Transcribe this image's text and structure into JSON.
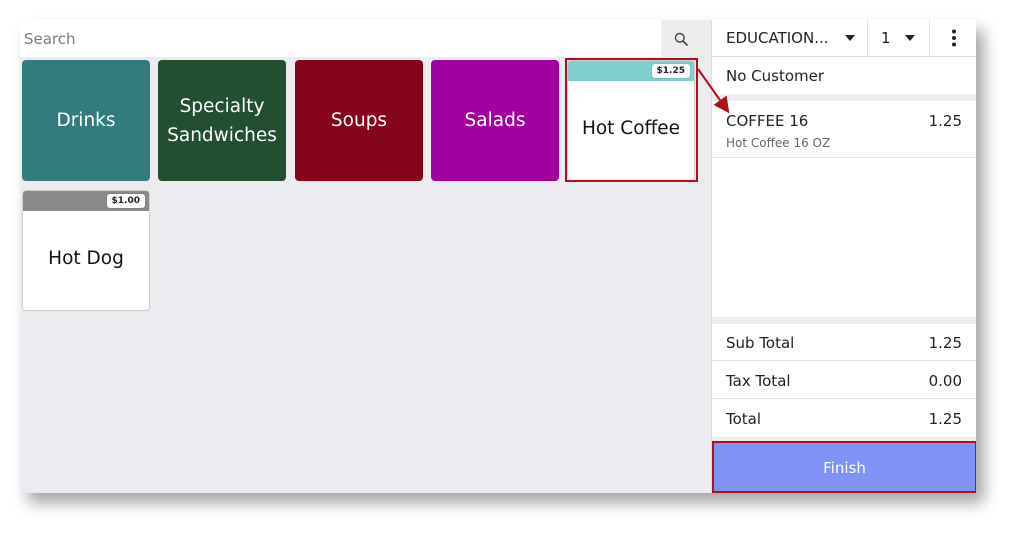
{
  "search": {
    "placeholder": "Search"
  },
  "categories": [
    {
      "label": "Drinks",
      "color": "#327b7e"
    },
    {
      "label": "Specialty\nSandwiches",
      "color": "#214f30"
    },
    {
      "label": "Soups",
      "color": "#85061a"
    },
    {
      "label": "Salads",
      "color": "#a2009f"
    }
  ],
  "products": [
    {
      "label": "Hot Coffee",
      "price": "$1.25",
      "band_color": "#7fd0cc"
    },
    {
      "label": "Hot Dog",
      "price": "$1.00",
      "band_color": "#8a8a8a"
    }
  ],
  "header": {
    "location": "EDUCATION...",
    "count": "1"
  },
  "customer": "No Customer",
  "order": [
    {
      "name": "COFFEE 16",
      "price": "1.25",
      "desc": "Hot Coffee 16 OZ"
    }
  ],
  "totals": {
    "sub_label": "Sub Total",
    "sub_value": "1.25",
    "tax_label": "Tax Total",
    "tax_value": "0.00",
    "total_label": "Total",
    "total_value": "1.25"
  },
  "finish_label": "Finish",
  "colors": {
    "accent": "#7f93f5",
    "highlight": "#b0101a"
  }
}
